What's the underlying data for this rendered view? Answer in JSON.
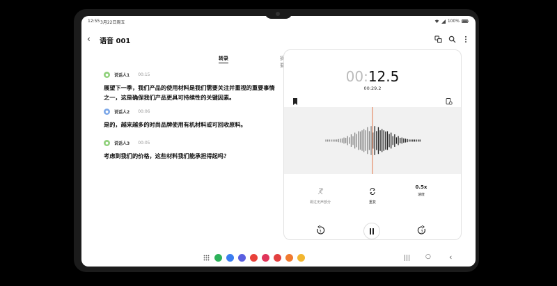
{
  "status": {
    "time": "12:55",
    "date": "3月22日周五",
    "battery": "100%"
  },
  "header": {
    "title": "语音 001"
  },
  "tabs": [
    {
      "label": "转录",
      "active": true
    },
    {
      "label": "摘要",
      "active": false
    }
  ],
  "transcript": [
    {
      "speaker": "说话人1",
      "time": "00:15",
      "color": "#8fd07a",
      "text": "展望下一季，我们产品的使用材料是我们需要关注并重视的重要事情之一，这是确保我们产品更具可持续性的关键因素。"
    },
    {
      "speaker": "说话人2",
      "time": "00:06",
      "color": "#7aa6e8",
      "text": "是的，越来越多的时尚品牌使用有机材料或可回收原料。"
    },
    {
      "speaker": "说话人3",
      "time": "00:05",
      "color": "#8fd07a",
      "text": "考虑到我们的价格，这些材料我们能承担得起吗？"
    }
  ],
  "player": {
    "time_dim": "00:",
    "time_main": "12.5",
    "subtime": "00:29.2",
    "controls": [
      {
        "label": "跳过无声部分",
        "icon": "skip-silence-icon"
      },
      {
        "label": "重复",
        "icon": "repeat-icon"
      },
      {
        "label": "速度",
        "value": "0.5x"
      }
    ]
  },
  "dock": {
    "apps": [
      {
        "name": "dock-app-phone",
        "color": "#2db25a"
      },
      {
        "name": "dock-app-messages",
        "color": "#3b7df0"
      },
      {
        "name": "dock-app-internet",
        "color": "#5a5fe0"
      },
      {
        "name": "dock-app-notes",
        "color": "#e8413a"
      },
      {
        "name": "dock-app-gallery",
        "color": "#e0355a"
      },
      {
        "name": "dock-app-camera",
        "color": "#e24040"
      },
      {
        "name": "dock-app-contacts",
        "color": "#f07a30"
      },
      {
        "name": "dock-app-files",
        "color": "#f2b630"
      }
    ]
  }
}
